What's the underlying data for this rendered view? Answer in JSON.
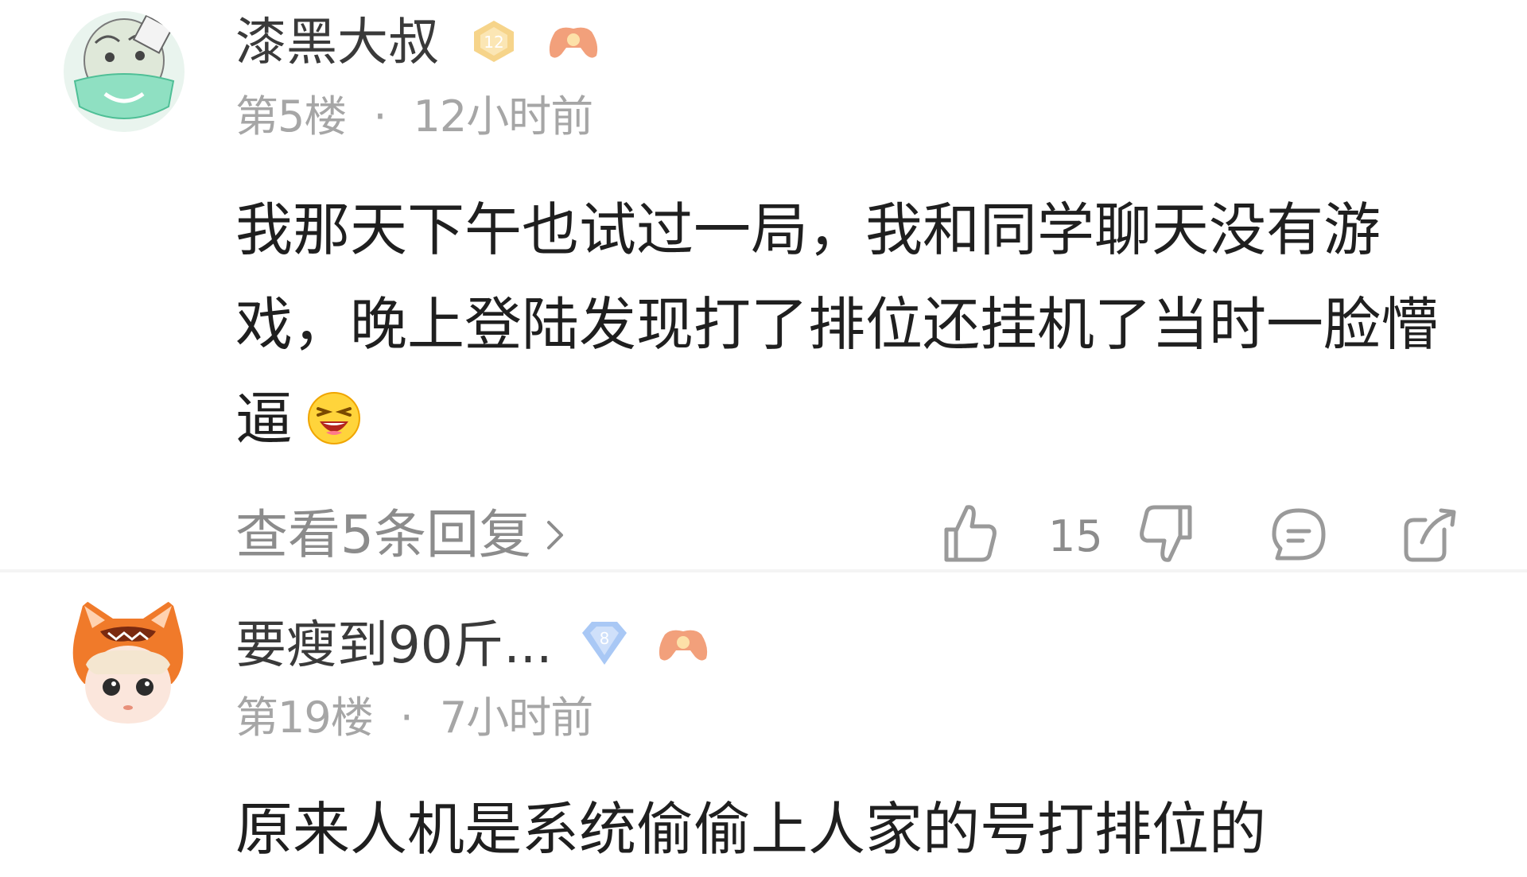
{
  "comments": [
    {
      "username": "漆黑大叔",
      "level_badge": "12",
      "floor": "第5楼",
      "separator": "·",
      "time": "12小时前",
      "text": "我那天下午也试过一局，我和同学聊天没有游戏，晚上登陆发现打了排位还挂机了当时一脸懵逼",
      "emoji": "grinning-squint-emoji",
      "view_replies": "查看5条回复",
      "like_count": "15",
      "icons": [
        "thumbs-up-icon",
        "thumbs-down-icon",
        "comment-bubble-icon",
        "share-icon"
      ]
    },
    {
      "username": "要瘦到90斤...",
      "level_badge": "8",
      "floor": "第19楼",
      "separator": "·",
      "time": "7小时前",
      "text": "原来人机是系统偷偷上人家的号打排位的"
    }
  ],
  "colors": {
    "text_primary": "#1f1f1f",
    "text_secondary": "#a6a6a6",
    "badge_gold": "#f6d48a",
    "badge_blue": "#a9c8f5",
    "badge_orange": "#f2a07b"
  }
}
